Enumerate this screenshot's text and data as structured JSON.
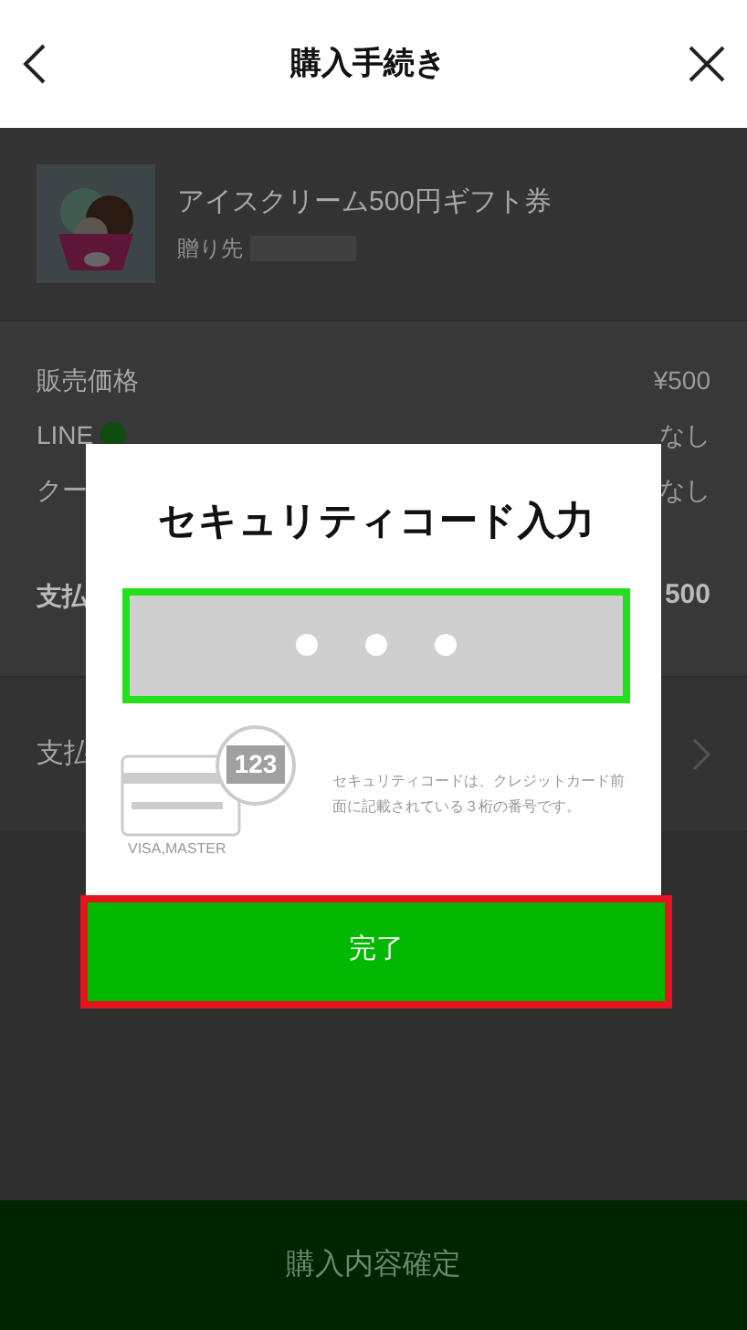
{
  "header": {
    "title": "購入手続き"
  },
  "product": {
    "name": "アイスクリーム500円ギフト券",
    "recipient_label": "贈り先"
  },
  "price_rows": [
    {
      "label": "販売価格",
      "value": "¥500",
      "bold": false,
      "badge": false
    },
    {
      "label": "LINE",
      "value": "なし",
      "bold": false,
      "badge": true
    },
    {
      "label": "クー",
      "value": "なし",
      "bold": false,
      "badge": false
    },
    {
      "label": "支払",
      "value": "500",
      "bold": true,
      "badge": false
    }
  ],
  "payment_row": {
    "label": "支払"
  },
  "confirm_button": "購入内容確定",
  "dialog": {
    "title": "セキュリティコード入力",
    "card_digits": "123",
    "card_brand": "VISA,MASTER",
    "hint": "セキュリティコードは、クレジットカード前面に記載されている３桁の番号です。",
    "done_button": "完了"
  }
}
